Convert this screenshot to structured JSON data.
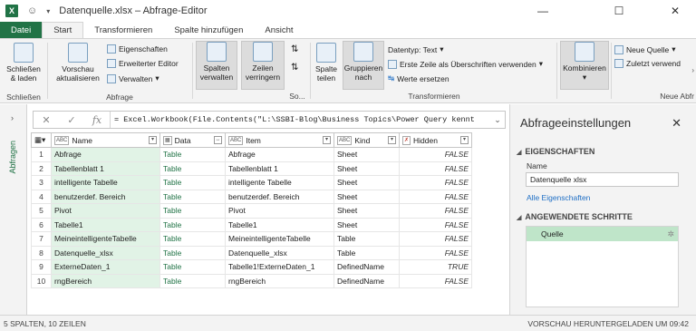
{
  "titlebar": {
    "title": "Datenquelle.xlsx – Abfrage-Editor",
    "app_icon": "X",
    "minimize": "—",
    "maximize": "☐",
    "close": "✕"
  },
  "tabs": [
    "Datei",
    "Start",
    "Transformieren",
    "Spalte hinzufügen",
    "Ansicht"
  ],
  "ribbon": {
    "schliessen": {
      "btn": "Schließen & laden",
      "label": "Schließen"
    },
    "abfrage": {
      "vorschau": "Vorschau aktualisieren",
      "eigenschaften": "Eigenschaften",
      "erweiterter_editor": "Erweiterter Editor",
      "verwalten": "Verwalten",
      "label": "Abfrage"
    },
    "spalten_verwalten": "Spalten verwalten",
    "zeilen_verringern": "Zeilen verringern",
    "so_label": "So...",
    "spalte_teilen": "Spalte teilen",
    "gruppieren": "Gruppieren nach",
    "datentyp": "Datentyp: Text",
    "erste_zeile": "Erste Zeile als Überschriften verwenden",
    "werte_ersetzen": "Werte ersetzen",
    "transformieren_label": "Transformieren",
    "kombinieren": "Kombinieren",
    "neue_quelle": "Neue Quelle",
    "zuletzt": "Zuletzt verwend",
    "neue_abfr_label": "Neue Abfr"
  },
  "leftpane": {
    "label": "Abfragen",
    "chevron": "›"
  },
  "formula": {
    "text": "= Excel.Workbook(File.Contents(\"L:\\SSBI-Blog\\Business Topics\\Power Query kennt",
    "fx": "fx",
    "cancel": "✕",
    "confirm": "✓"
  },
  "grid": {
    "columns": [
      {
        "type": "ABC",
        "name": "Name"
      },
      {
        "type": "▦",
        "name": "Data"
      },
      {
        "type": "ABC",
        "name": "Item"
      },
      {
        "type": "ABC",
        "name": "Kind"
      },
      {
        "type": "✗",
        "name": "Hidden"
      }
    ],
    "rows": [
      {
        "n": "1",
        "name": "Abfrage",
        "data": "Table",
        "item": "Abfrage",
        "kind": "Sheet",
        "hidden": "FALSE"
      },
      {
        "n": "2",
        "name": "Tabellenblatt 1",
        "data": "Table",
        "item": "Tabellenblatt 1",
        "kind": "Sheet",
        "hidden": "FALSE"
      },
      {
        "n": "3",
        "name": "intelligente Tabelle",
        "data": "Table",
        "item": "intelligente Tabelle",
        "kind": "Sheet",
        "hidden": "FALSE"
      },
      {
        "n": "4",
        "name": "benutzerdef. Bereich",
        "data": "Table",
        "item": "benutzerdef. Bereich",
        "kind": "Sheet",
        "hidden": "FALSE"
      },
      {
        "n": "5",
        "name": "Pivot",
        "data": "Table",
        "item": "Pivot",
        "kind": "Sheet",
        "hidden": "FALSE"
      },
      {
        "n": "6",
        "name": "Tabelle1",
        "data": "Table",
        "item": "Tabelle1",
        "kind": "Sheet",
        "hidden": "FALSE"
      },
      {
        "n": "7",
        "name": "MeineintelligenteTabelle",
        "data": "Table",
        "item": "MeineintelligenteTabelle",
        "kind": "Table",
        "hidden": "FALSE"
      },
      {
        "n": "8",
        "name": "Datenquelle_xlsx",
        "data": "Table",
        "item": "Datenquelle_xlsx",
        "kind": "Table",
        "hidden": "FALSE"
      },
      {
        "n": "9",
        "name": "ExterneDaten_1",
        "data": "Table",
        "item": "Tabelle1!ExterneDaten_1",
        "kind": "DefinedName",
        "hidden": "TRUE"
      },
      {
        "n": "10",
        "name": "rngBereich",
        "data": "Table",
        "item": "rngBereich",
        "kind": "DefinedName",
        "hidden": "FALSE"
      }
    ]
  },
  "rightpane": {
    "title": "Abfrageeinstellungen",
    "close": "✕",
    "eigenschaften": "EIGENSCHAFTEN",
    "name_label": "Name",
    "name_value": "Datenquelle xlsx",
    "alle_eigenschaften": "Alle Eigenschaften",
    "angewendete": "ANGEWENDETE SCHRITTE",
    "steps": [
      "Quelle"
    ]
  },
  "status": {
    "left": "5 SPALTEN, 10 ZEILEN",
    "right": "VORSCHAU HERUNTERGELADEN UM 09:42"
  },
  "colors": {
    "excel_green": "#217346",
    "name_col": "#e1f3e6",
    "step_sel": "#bfe5c9",
    "link": "#1f6fc5"
  }
}
